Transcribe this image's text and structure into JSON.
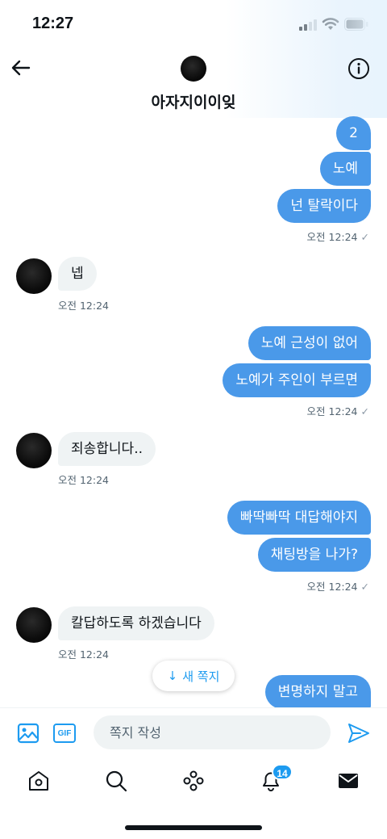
{
  "status": {
    "time": "12:27"
  },
  "header": {
    "title": "아자지이이잊"
  },
  "messages": {
    "m1": "2",
    "m2": "노예",
    "m3": "넌 탈락이다",
    "m3_time": "오전 12:24",
    "r1": "넵",
    "r1_time": "오전 12:24",
    "m4": "노예 근성이 없어",
    "m5": "노예가 주인이 부르면",
    "m5_time": "오전 12:24",
    "r2": "죄송합니다..",
    "r2_time": "오전 12:24",
    "m6": "빠딱빠딱 대답해야지",
    "m7": "채팅방을 나가?",
    "m7_time": "오전 12:24",
    "r3": "칼답하도록 하겠습니다",
    "r3_time": "오전 12:24",
    "m8": "변명하지 말고"
  },
  "new_message_pill": {
    "label": "새 쪽지",
    "icon": "arrow-down-icon"
  },
  "composer": {
    "placeholder": "쪽지 작성",
    "gif_label": "GIF"
  },
  "tabbar": {
    "notifications_badge": "14"
  },
  "colors": {
    "sent_bubble": "#4a99e9",
    "received_bubble": "#eff3f4",
    "accent": "#1d9bf0"
  }
}
